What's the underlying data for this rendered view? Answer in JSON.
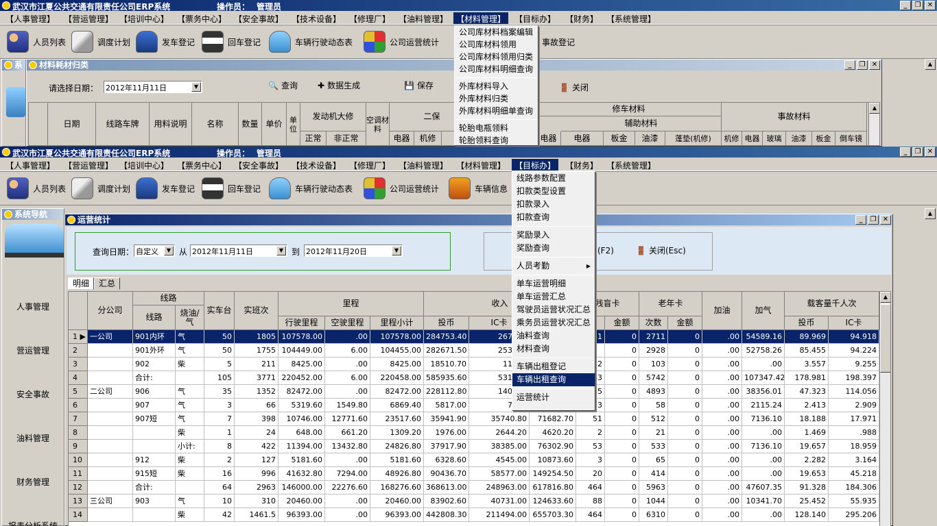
{
  "app": {
    "title": "武汉市江夏公共交通有限责任公司ERP系统",
    "operator_label": "操作员：",
    "operator": "管理员"
  },
  "window_buttons": {
    "min": "_",
    "max": "❐",
    "close": "✕"
  },
  "menu": [
    {
      "label": "【人事管理】"
    },
    {
      "label": "【营运管理】"
    },
    {
      "label": "【培训中心】"
    },
    {
      "label": "【票务中心】"
    },
    {
      "label": "【安全事故】"
    },
    {
      "label": "【技术设备】"
    },
    {
      "label": "【修理厂】"
    },
    {
      "label": "【油料管理】"
    },
    {
      "label": "【材料管理】"
    },
    {
      "label": "【目标办】"
    },
    {
      "label": "【财务】"
    },
    {
      "label": "【系统管理】"
    }
  ],
  "toolbar": {
    "items": [
      {
        "label": "人员列表",
        "icon": "people-icon"
      },
      {
        "label": "调度计划",
        "icon": "plan-icon"
      },
      {
        "label": "发车登记",
        "icon": "depart-icon"
      },
      {
        "label": "回车登记",
        "icon": "return-icon"
      },
      {
        "label": "车辆行驶动态表",
        "icon": "bus-icon"
      },
      {
        "label": "公司运营统计",
        "icon": "stats-icon"
      },
      {
        "label": "车辆信息",
        "icon": "truck-icon"
      }
    ],
    "accident": "事故登记"
  },
  "material_menu": {
    "items": [
      "公司库材料档案编辑",
      "公司库材料领用",
      "公司库材料领用归类",
      "公司库材料明细查询",
      "外库材料导入",
      "外库材料归类",
      "外库材料明细单查询",
      "轮胎电瓶领料",
      "轮胎领料查询"
    ]
  },
  "material_window": {
    "title": "材料耗材归类",
    "nav_title": "系",
    "date_label": "请选择日期：",
    "date": "2012年11月11日",
    "query": "查询",
    "generate": "数据生成",
    "save": "保存",
    "close": "关闭",
    "headers": {
      "date": "日期",
      "route_plate": "线路车牌",
      "usage": "用料说明",
      "name": "名称",
      "qty": "数量",
      "price": "单价",
      "unit": "单位",
      "engine": "发动机大修",
      "normal": "正常",
      "abnormal": "非正常",
      "ac": "空调材料",
      "second": "二保",
      "electric": "电器",
      "mech": "机修",
      "other": "刹",
      "repair": "修车材料",
      "aux": "辅助材料",
      "electric2": "电器",
      "sheet": "板金",
      "paint": "油漆",
      "gasket": "蓬垫(机修)",
      "accident": "事故材料",
      "mech2": "机修",
      "elec3": "电器",
      "glass": "玻璃",
      "paint2": "油漆",
      "sheet2": "板金",
      "reverse": "倒车镜"
    }
  },
  "target_menu": {
    "items": [
      "线路参数配置",
      "扣款类型设置",
      "扣款录入",
      "扣款查询",
      "奖励录入",
      "奖励查询",
      "人员考勤",
      "单车运营明细",
      "单车运营汇总",
      "驾驶员运营状况汇总",
      "乘务员运营状况汇总",
      "油料查询",
      "材料查询",
      "车辆出租登记",
      "车辆出租查询",
      "运营统计"
    ]
  },
  "nav": {
    "title": "系统导航",
    "items": [
      "人事管理",
      "营运管理",
      "安全事故",
      "油料管理",
      "财务管理",
      "报表分析系统"
    ]
  },
  "ops": {
    "title": "运营统计",
    "date_label": "查询日期：",
    "mode": "自定义",
    "from_label": "从",
    "from": "2012年11月11日",
    "to_label": "到",
    "to": "2012年11月20日",
    "f2": "(F2)",
    "close": "关闭(Esc)",
    "tabs": [
      "明细",
      "汇总"
    ],
    "headers": {
      "branch": "分公司",
      "route_grp": "线路",
      "route": "线路",
      "fuel": "烧油/气",
      "real_cars": "实车台",
      "real_trips": "实班次",
      "mileage": "里程",
      "drive": "行驶里程",
      "empty": "空驶里程",
      "subtotal": "里程小计",
      "income": "收入",
      "coin": "投币",
      "ic": "IC卡",
      "blind": "残盲卡",
      "amount": "金额",
      "senior": "老年卡",
      "count": "次数",
      "amount2": "金额",
      "oil": "加油",
      "gas": "加气",
      "passengers": "载客量千人次",
      "coin2": "投币",
      "ic2": "IC卡"
    },
    "rows": [
      {
        "n": "1",
        "branch": "一公司",
        "route": "901内环",
        "fuel": "气",
        "cars": "50",
        "trips": "1805",
        "drive": "107578.00",
        "empty": ".00",
        "sub": "107578.00",
        "coin": "284753.40",
        "ic": "267188",
        "inc3": "",
        "bc": "41",
        "ba": "0",
        "sc": "2711",
        "sa": "0",
        "oil": ".00",
        "gas": "54589.16",
        "pc": "89.969",
        "pi": "94.918"
      },
      {
        "n": "2",
        "branch": "",
        "route": "901外环",
        "fuel": "气",
        "cars": "50",
        "trips": "1755",
        "drive": "104449.00",
        "empty": "6.00",
        "sub": "104455.00",
        "coin": "282671.50",
        "ic": "253095",
        "inc3": "",
        "bc": "",
        "ba": "0",
        "sc": "2928",
        "sa": "0",
        "oil": ".00",
        "gas": "52758.26",
        "pc": "85.455",
        "pi": "94.224"
      },
      {
        "n": "3",
        "branch": "",
        "route": "902",
        "fuel": "柴",
        "cars": "5",
        "trips": "211",
        "drive": "8425.00",
        "empty": ".00",
        "sub": "8425.00",
        "coin": "18510.70",
        "ic": "11625",
        "inc3": "",
        "bc": "2",
        "ba": "0",
        "sc": "103",
        "sa": "0",
        "oil": ".00",
        "gas": ".00",
        "pc": "3.557",
        "pi": "9.255"
      },
      {
        "n": "4",
        "branch": "",
        "route": "合计:",
        "fuel": "",
        "cars": "105",
        "trips": "3771",
        "drive": "220452.00",
        "empty": "6.00",
        "sub": "220458.00",
        "coin": "585935.60",
        "ic": "531908",
        "inc3": "",
        "bc": "43",
        "ba": "0",
        "sc": "5742",
        "sa": "0",
        "oil": ".00",
        "gas": "107347.42",
        "pc": "178.981",
        "pi": "198.397"
      },
      {
        "n": "5",
        "branch": "二公司",
        "route": "906",
        "fuel": "气",
        "cars": "35",
        "trips": "1352",
        "drive": "82472.00",
        "empty": ".00",
        "sub": "82472.00",
        "coin": "228112.80",
        "ic": "140022",
        "inc3": "",
        "bc": "45",
        "ba": "0",
        "sc": "4893",
        "sa": "0",
        "oil": ".00",
        "gas": "38356.01",
        "pc": "47.323",
        "pi": "114.056"
      },
      {
        "n": "6",
        "branch": "",
        "route": "907",
        "fuel": "气",
        "cars": "3",
        "trips": "66",
        "drive": "5319.60",
        "empty": "1549.80",
        "sub": "6869.40",
        "coin": "5817.00",
        "ic": "7434",
        "inc3": "",
        "bc": "3",
        "ba": "0",
        "sc": "58",
        "sa": "0",
        "oil": ".00",
        "gas": "2115.24",
        "pc": "2.413",
        "pi": "2.909"
      },
      {
        "n": "7",
        "branch": "",
        "route": "907短",
        "fuel": "气",
        "cars": "7",
        "trips": "398",
        "drive": "10746.00",
        "empty": "12771.60",
        "sub": "23517.60",
        "coin": "35941.90",
        "ic": "35740.80",
        "inc3": "71682.70",
        "bc": "51",
        "ba": "0",
        "sc": "512",
        "sa": "0",
        "oil": ".00",
        "gas": "7136.10",
        "pc": "18.188",
        "pi": "17.971"
      },
      {
        "n": "8",
        "branch": "",
        "route": "",
        "fuel": "柴",
        "cars": "1",
        "trips": "24",
        "drive": "648.00",
        "empty": "661.20",
        "sub": "1309.20",
        "coin": "1976.00",
        "ic": "2644.20",
        "inc3": "4620.20",
        "bc": "2",
        "ba": "0",
        "sc": "21",
        "sa": "0",
        "oil": ".00",
        "gas": ".00",
        "pc": "1.469",
        "pi": ".988"
      },
      {
        "n": "9",
        "branch": "",
        "route": "",
        "fuel": "小计:",
        "cars": "8",
        "trips": "422",
        "drive": "11394.00",
        "empty": "13432.80",
        "sub": "24826.80",
        "coin": "37917.90",
        "ic": "38385.00",
        "inc3": "76302.90",
        "bc": "53",
        "ba": "0",
        "sc": "533",
        "sa": "0",
        "oil": ".00",
        "gas": "7136.10",
        "pc": "19.657",
        "pi": "18.959"
      },
      {
        "n": "10",
        "branch": "",
        "route": "912",
        "fuel": "柴",
        "cars": "2",
        "trips": "127",
        "drive": "5181.60",
        "empty": ".00",
        "sub": "5181.60",
        "coin": "6328.60",
        "ic": "4545.00",
        "inc3": "10873.60",
        "bc": "3",
        "ba": "0",
        "sc": "65",
        "sa": "0",
        "oil": ".00",
        "gas": ".00",
        "pc": "2.282",
        "pi": "3.164"
      },
      {
        "n": "11",
        "branch": "",
        "route": "915短",
        "fuel": "柴",
        "cars": "16",
        "trips": "996",
        "drive": "41632.80",
        "empty": "7294.00",
        "sub": "48926.80",
        "coin": "90436.70",
        "ic": "58577.00",
        "inc3": "149254.50",
        "bc": "20",
        "ba": "0",
        "sc": "414",
        "sa": "0",
        "oil": ".00",
        "gas": ".00",
        "pc": "19.653",
        "pi": "45.218"
      },
      {
        "n": "12",
        "branch": "",
        "route": "合计:",
        "fuel": "",
        "cars": "64",
        "trips": "2963",
        "drive": "146000.00",
        "empty": "22276.60",
        "sub": "168276.60",
        "coin": "368613.00",
        "ic": "248963.00",
        "inc3": "617816.80",
        "bc": "464",
        "ba": "0",
        "sc": "5963",
        "sa": "0",
        "oil": ".00",
        "gas": "47607.35",
        "pc": "91.328",
        "pi": "184.306"
      },
      {
        "n": "13",
        "branch": "三公司",
        "route": "903",
        "fuel": "气",
        "cars": "10",
        "trips": "310",
        "drive": "20460.00",
        "empty": ".00",
        "sub": "20460.00",
        "coin": "83902.60",
        "ic": "40731.00",
        "inc3": "124633.60",
        "bc": "88",
        "ba": "0",
        "sc": "1044",
        "sa": "0",
        "oil": ".00",
        "gas": "10341.70",
        "pc": "25.452",
        "pi": "55.935"
      },
      {
        "n": "14",
        "branch": "",
        "route": "",
        "fuel": "柴",
        "cars": "42",
        "trips": "1461.5",
        "drive": "96393.00",
        "empty": ".00",
        "sub": "96393.00",
        "coin": "442808.30",
        "ic": "211494.00",
        "inc3": "655703.30",
        "bc": "464",
        "ba": "0",
        "sc": "6310",
        "sa": "0",
        "oil": ".00",
        "gas": ".00",
        "pc": "128.140",
        "pi": "295.206"
      }
    ]
  }
}
